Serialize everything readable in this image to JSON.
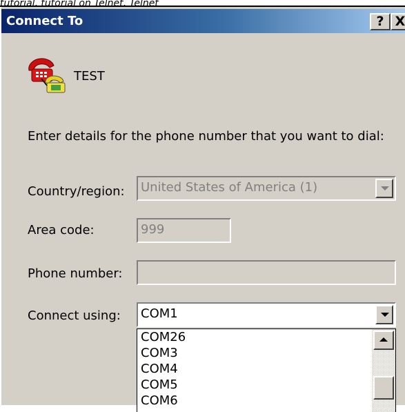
{
  "top_strip_text": "tutorial, tutorial on Telnet, Telnet",
  "dialog": {
    "title": "Connect To",
    "help_button": "?",
    "close_button": "X"
  },
  "connection": {
    "icon": "phone-connection-icon",
    "name": "TEST"
  },
  "instructions": "Enter details for the phone number that you want to dial:",
  "fields": {
    "country_label": "Country/region:",
    "country_value": "United States of America (1)",
    "area_label": "Area code:",
    "area_value": "999",
    "phone_label": "Phone number:",
    "phone_value": "",
    "connect_label": "Connect using:",
    "connect_value": "COM1"
  },
  "dropdown": {
    "options": [
      "COM26",
      "COM3",
      "COM4",
      "COM5",
      "COM6"
    ]
  },
  "colors": {
    "title_gradient_start": "#0a246a",
    "title_gradient_end": "#a6caf0",
    "dialog_bg": "#d4d0c8"
  }
}
